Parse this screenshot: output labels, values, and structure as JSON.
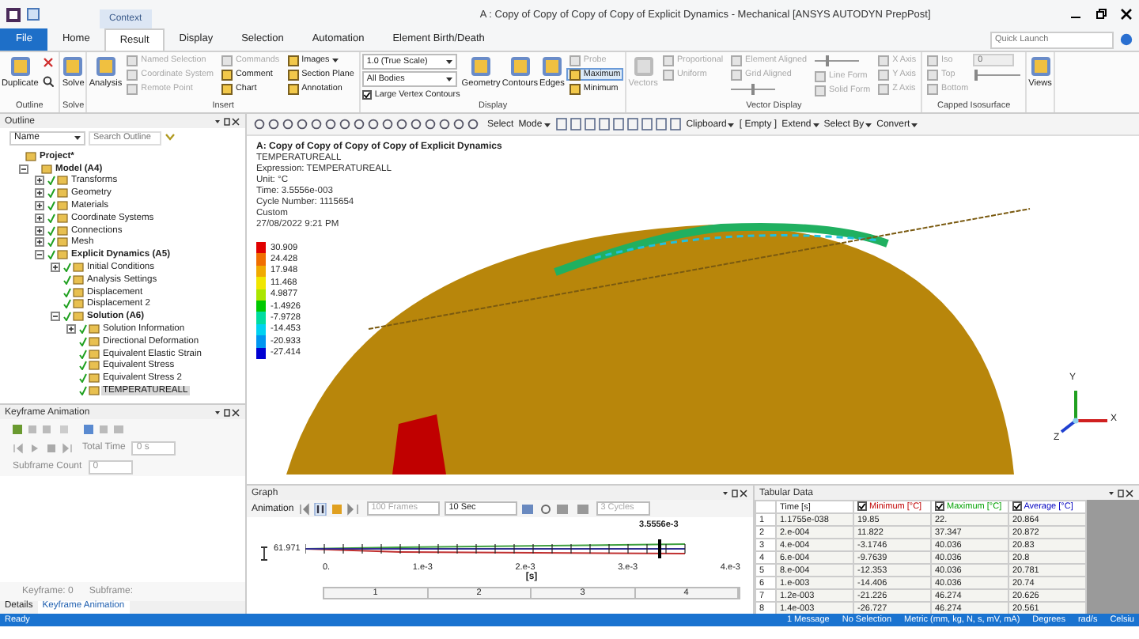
{
  "title_bar": {
    "context_label": "Context",
    "title": "A : Copy of Copy of Copy of Copy of Explicit Dynamics - Mechanical [ANSYS AUTODYN PrepPost]",
    "quick_launch": {
      "placeholder": "Quick Launch"
    }
  },
  "tabs": [
    {
      "label": "File",
      "kind": "file",
      "selected": false
    },
    {
      "label": "Home",
      "kind": "tab",
      "selected": false
    },
    {
      "label": "Result",
      "kind": "tab",
      "selected": true
    },
    {
      "label": "Display",
      "kind": "tab",
      "selected": false
    },
    {
      "label": "Selection",
      "kind": "tab",
      "selected": false
    },
    {
      "label": "Automation",
      "kind": "tab",
      "selected": false
    },
    {
      "label": "Element Birth/Death",
      "kind": "tab",
      "selected": false
    }
  ],
  "ribbon": {
    "groups": [
      {
        "label": "Outline",
        "columns": [
          [
            {
              "kind": "large",
              "label": "Duplicate"
            }
          ],
          [
            {
              "kind": "delete"
            },
            {
              "kind": "find"
            }
          ]
        ]
      },
      {
        "label": "Solve",
        "columns": [
          [
            {
              "kind": "large",
              "label": "Solve"
            }
          ]
        ]
      },
      {
        "label": "Insert",
        "columns": [
          [
            {
              "kind": "large",
              "label": "Analysis"
            }
          ],
          [
            {
              "kind": "small",
              "label": "Named Selection",
              "disabled": true
            },
            {
              "kind": "small",
              "label": "Coordinate System",
              "disabled": true
            },
            {
              "kind": "small",
              "label": "Remote Point",
              "disabled": true
            }
          ],
          [
            {
              "kind": "small",
              "label": "Commands",
              "disabled": true
            },
            {
              "kind": "small",
              "label": "Comment",
              "disabled": false
            },
            {
              "kind": "small",
              "label": "Chart",
              "disabled": false
            }
          ],
          [
            {
              "kind": "small",
              "label": "Images",
              "menu": true,
              "disabled": false
            },
            {
              "kind": "small",
              "label": "Section Plane",
              "disabled": false
            },
            {
              "kind": "small",
              "label": "Annotation",
              "disabled": false
            }
          ]
        ]
      },
      {
        "label": "Display",
        "columns": [
          [
            {
              "kind": "dropdown",
              "value": "1.0 (True Scale)"
            },
            {
              "kind": "dropdown",
              "value": "All Bodies"
            },
            {
              "kind": "checkbox",
              "label": "Large Vertex Contours",
              "checked": true
            }
          ],
          [
            {
              "kind": "large",
              "label": "Geometry"
            }
          ],
          [
            {
              "kind": "large",
              "label": "Contours"
            }
          ],
          [
            {
              "kind": "large",
              "label": "Edges"
            }
          ],
          [
            {
              "kind": "small",
              "label": "Probe",
              "disabled": true,
              "selected": false
            },
            {
              "kind": "small",
              "label": "Maximum",
              "disabled": false,
              "selected": true
            },
            {
              "kind": "small",
              "label": "Minimum",
              "disabled": false,
              "selected": false
            }
          ]
        ]
      },
      {
        "label": "Vector Display",
        "columns": [
          [
            {
              "kind": "large",
              "label": "Vectors",
              "disabled": true
            }
          ],
          [
            {
              "kind": "small",
              "label": "Proportional",
              "disabled": true
            },
            {
              "kind": "small",
              "label": "Uniform",
              "disabled": true
            }
          ],
          [
            {
              "kind": "small",
              "label": "Element Aligned",
              "disabled": true
            },
            {
              "kind": "small",
              "label": "Grid Aligned",
              "disabled": true
            },
            {
              "kind": "slider",
              "level": 0.5
            }
          ],
          [
            {
              "kind": "slider",
              "level": 0.3
            },
            {
              "kind": "small",
              "label": "Line Form",
              "disabled": true
            },
            {
              "kind": "small",
              "label": "Solid Form",
              "disabled": true
            }
          ],
          [
            {
              "kind": "small",
              "label": "X Axis",
              "disabled": true
            },
            {
              "kind": "small",
              "label": "Y Axis",
              "disabled": true
            },
            {
              "kind": "small",
              "label": "Z Axis",
              "disabled": true
            }
          ]
        ]
      },
      {
        "label": "Capped Isosurface",
        "columns": [
          [
            {
              "kind": "small",
              "label": "Iso",
              "disabled": true
            },
            {
              "kind": "small",
              "label": "Top",
              "disabled": true
            },
            {
              "kind": "small",
              "label": "Bottom",
              "disabled": true
            }
          ],
          [
            {
              "kind": "field",
              "placeholder": "0"
            },
            {
              "kind": "slider",
              "level": 0
            }
          ]
        ]
      },
      {
        "columns": [
          [
            {
              "kind": "large",
              "label": "Views"
            }
          ]
        ]
      }
    ]
  },
  "toolbar": {
    "buttons": [
      {
        "label": "Select",
        "menu": false
      },
      {
        "label": "Mode",
        "menu": true
      }
    ],
    "right_buttons": [
      {
        "label": "Clipboard",
        "menu": true
      },
      {
        "label": "[ Empty ]",
        "menu": false
      },
      {
        "label": "Extend",
        "menu": true
      },
      {
        "label": "Select By",
        "menu": true
      },
      {
        "label": "Convert",
        "menu": true
      }
    ]
  },
  "outline": {
    "title": "Outline",
    "filter": "Name",
    "search": {
      "placeholder": "Search Outline"
    },
    "tree": [
      {
        "label": "Project*",
        "solved": false,
        "selected": false,
        "children": [
          {
            "label": "Model (A4)",
            "expanded": true,
            "solved": false,
            "selected": false,
            "children": [
              {
                "label": "Transforms",
                "expanded": false,
                "solved": true,
                "selected": false
              },
              {
                "label": "Geometry",
                "expanded": false,
                "solved": true,
                "selected": false
              },
              {
                "label": "Materials",
                "expanded": false,
                "solved": true,
                "selected": false
              },
              {
                "label": "Coordinate Systems",
                "expanded": false,
                "solved": true,
                "selected": false
              },
              {
                "label": "Connections",
                "expanded": false,
                "solved": true,
                "selected": false
              },
              {
                "label": "Mesh",
                "expanded": false,
                "solved": true,
                "selected": false
              },
              {
                "label": "Explicit Dynamics (A5)",
                "expanded": true,
                "solved": true,
                "selected": false,
                "children": [
                  {
                    "label": "Initial Conditions",
                    "expanded": false,
                    "solved": true,
                    "selected": false
                  },
                  {
                    "label": "Analysis Settings",
                    "solved": true,
                    "selected": false
                  },
                  {
                    "label": "Displacement",
                    "solved": true,
                    "selected": false
                  },
                  {
                    "label": "Displacement 2",
                    "solved": true,
                    "selected": false
                  },
                  {
                    "label": "Solution (A6)",
                    "expanded": true,
                    "solved": true,
                    "selected": false,
                    "children": [
                      {
                        "label": "Solution Information",
                        "expanded": false,
                        "solved": true,
                        "selected": false
                      },
                      {
                        "label": "Directional Deformation",
                        "solved": true,
                        "selected": false
                      },
                      {
                        "label": "Equivalent Elastic Strain",
                        "solved": true,
                        "selected": false
                      },
                      {
                        "label": "Equivalent Stress",
                        "solved": true,
                        "selected": false
                      },
                      {
                        "label": "Equivalent Stress 2",
                        "solved": true,
                        "selected": false
                      },
                      {
                        "label": "TEMPERATUREALL",
                        "solved": true,
                        "selected": true
                      }
                    ]
                  }
                ]
              }
            ]
          }
        ]
      }
    ]
  },
  "keyframe": {
    "title": "Keyframe Animation",
    "total_time_label": "Total Time",
    "total_time": "0 s",
    "subframe_count_label": "Subframe Count",
    "subframe_count": "0",
    "keyframe": "Keyframe: 0",
    "subframe": "Subframe:"
  },
  "panel_tabs": [
    {
      "label": "Details",
      "selected": false
    },
    {
      "label": "Keyframe Animation",
      "selected": true
    }
  ],
  "viewport": {
    "title": "A: Copy of Copy of Copy of Copy of Explicit Dynamics",
    "info": [
      "TEMPERATUREALL",
      "Expression: TEMPERATUREALL",
      "Unit: °C",
      "Time: 3.5556e-003",
      "Cycle Number: 1115654",
      "Custom",
      "27/08/2022 9:21 PM"
    ],
    "legend": [
      {
        "value": "30.909",
        "color": "#e00000"
      },
      {
        "value": "24.428",
        "color": "#f06e00"
      },
      {
        "value": "17.948",
        "color": "#f0aa00"
      },
      {
        "value": "11.468",
        "color": "#f0e600"
      },
      {
        "value": "4.9877",
        "color": "#aae600"
      },
      {
        "value": "-1.4926",
        "color": "#00c800"
      },
      {
        "value": "-7.9728",
        "color": "#00dca0"
      },
      {
        "value": "-14.453",
        "color": "#00d2f0"
      },
      {
        "value": "-20.933",
        "color": "#0096f0"
      },
      {
        "value": "-27.414",
        "color": "#0000d2"
      }
    ],
    "triad": {
      "x": "X",
      "y": "Y",
      "z": "Z"
    }
  },
  "graph": {
    "title": "Graph",
    "animation_label": "Animation",
    "frames": {
      "value": "100 Frames",
      "disabled": true
    },
    "duration": {
      "value": "10 Sec",
      "disabled": false
    },
    "cycles": {
      "value": "3 Cycles",
      "disabled": true
    },
    "y_value": "61.971",
    "marker": "3.5556e-3",
    "xticks": [
      "0.",
      "1.e-3",
      "2.e-3",
      "3.e-3",
      "4.e-3"
    ],
    "xlabel": "[s]",
    "segments": [
      "1",
      "2",
      "3",
      "4"
    ]
  },
  "tabular": {
    "title": "Tabular Data",
    "columns": [
      {
        "label": "Time [s]",
        "checked": false
      },
      {
        "label": "Minimum [°C]",
        "color": "#c00000",
        "checked": true
      },
      {
        "label": "Maximum [°C]",
        "color": "#00a000",
        "checked": true
      },
      {
        "label": "Average [°C]",
        "color": "#0000c0",
        "checked": true
      }
    ],
    "rows": [
      {
        "index": "1",
        "cells": [
          "1.1755e-038",
          "19.85",
          "22.",
          "20.864"
        ]
      },
      {
        "index": "2",
        "cells": [
          "2.e-004",
          "11.822",
          "37.347",
          "20.872"
        ]
      },
      {
        "index": "3",
        "cells": [
          "4.e-004",
          "-3.1746",
          "40.036",
          "20.83"
        ]
      },
      {
        "index": "4",
        "cells": [
          "6.e-004",
          "-9.7639",
          "40.036",
          "20.8"
        ]
      },
      {
        "index": "5",
        "cells": [
          "8.e-004",
          "-12.353",
          "40.036",
          "20.781"
        ]
      },
      {
        "index": "6",
        "cells": [
          "1.e-003",
          "-14.406",
          "40.036",
          "20.74"
        ]
      },
      {
        "index": "7",
        "cells": [
          "1.2e-003",
          "-21.226",
          "46.274",
          "20.626"
        ]
      },
      {
        "index": "8",
        "cells": [
          "1.4e-003",
          "-26.727",
          "46.274",
          "20.561"
        ]
      }
    ]
  },
  "status_bar": {
    "state": "Ready",
    "items": [
      "1 Message",
      "No Selection",
      "Metric (mm, kg, N, s, mV, mA)",
      "Degrees",
      "rad/s",
      "Celsiu"
    ]
  }
}
